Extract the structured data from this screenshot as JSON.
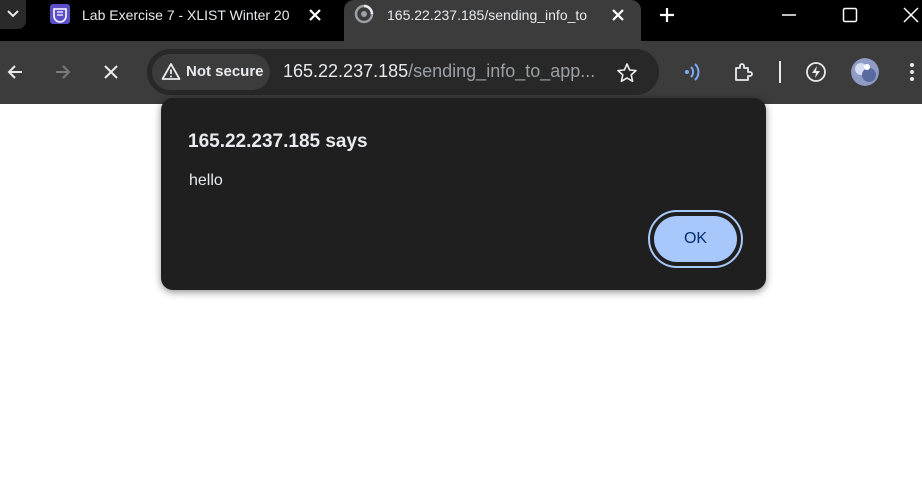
{
  "tabs": [
    {
      "title": "Lab Exercise 7 - XLIST Winter 20",
      "favicon": "course-logo-icon",
      "active": false
    },
    {
      "title": "165.22.237.185/sending_info_to",
      "favicon": "loading-spinner-icon",
      "active": true
    }
  ],
  "toolbar": {
    "security_chip": "Not secure",
    "url_host": "165.22.237.185",
    "url_path": "/sending_info_to_app..."
  },
  "dialog": {
    "title": "165.22.237.185 says",
    "message": "hello",
    "ok_label": "OK"
  },
  "colors": {
    "tab_strip": "#000000",
    "toolbar": "#3c3c3c",
    "dialog_bg": "#1f1f1f",
    "ok_button": "#a8c7fa",
    "accent_blue": "#7cacf8"
  }
}
